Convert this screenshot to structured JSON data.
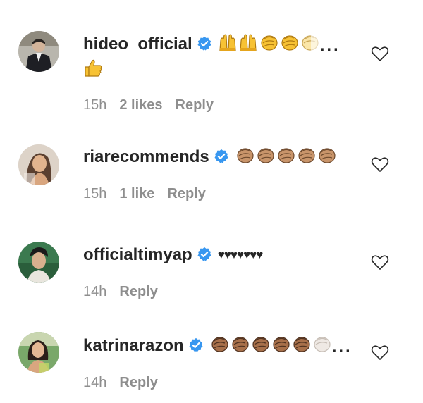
{
  "comments": [
    {
      "username": "hideo_official",
      "verified": true,
      "emojis_line1": [
        "raising-hands",
        "raising-hands",
        "clapping-hands",
        "clapping-hands",
        "clapping-hands-light"
      ],
      "ellipsis": "...",
      "emojis_line2": [
        "thumbs-up"
      ],
      "time": "15h",
      "likes": "2 likes",
      "reply": "Reply"
    },
    {
      "username": "riarecommends",
      "verified": true,
      "emojis_line1": [
        "clapping-hands-medium",
        "clapping-hands-medium",
        "clapping-hands-medium",
        "clapping-hands-medium",
        "clapping-hands-medium"
      ],
      "time": "15h",
      "likes": "1 like",
      "reply": "Reply"
    },
    {
      "username": "officialtimyap",
      "verified": true,
      "hearts": "♥♥♥♥♥♥♥",
      "time": "14h",
      "reply": "Reply"
    },
    {
      "username": "katrinarazon",
      "verified": true,
      "emojis_line1": [
        "clapping-hands-dark",
        "clapping-hands-dark",
        "clapping-hands-dark",
        "clapping-hands-dark",
        "clapping-hands-dark",
        "clapping-hands-faded"
      ],
      "ellipsis": "...",
      "time": "14h",
      "reply": "Reply"
    }
  ],
  "colors": {
    "verified_blue": "#3897f0",
    "meta_grey": "#8e8e8e",
    "text": "#262626",
    "emoji_yellow": "#f7c234",
    "emoji_medium": "#c8946a",
    "emoji_dark": "#a8704a"
  }
}
